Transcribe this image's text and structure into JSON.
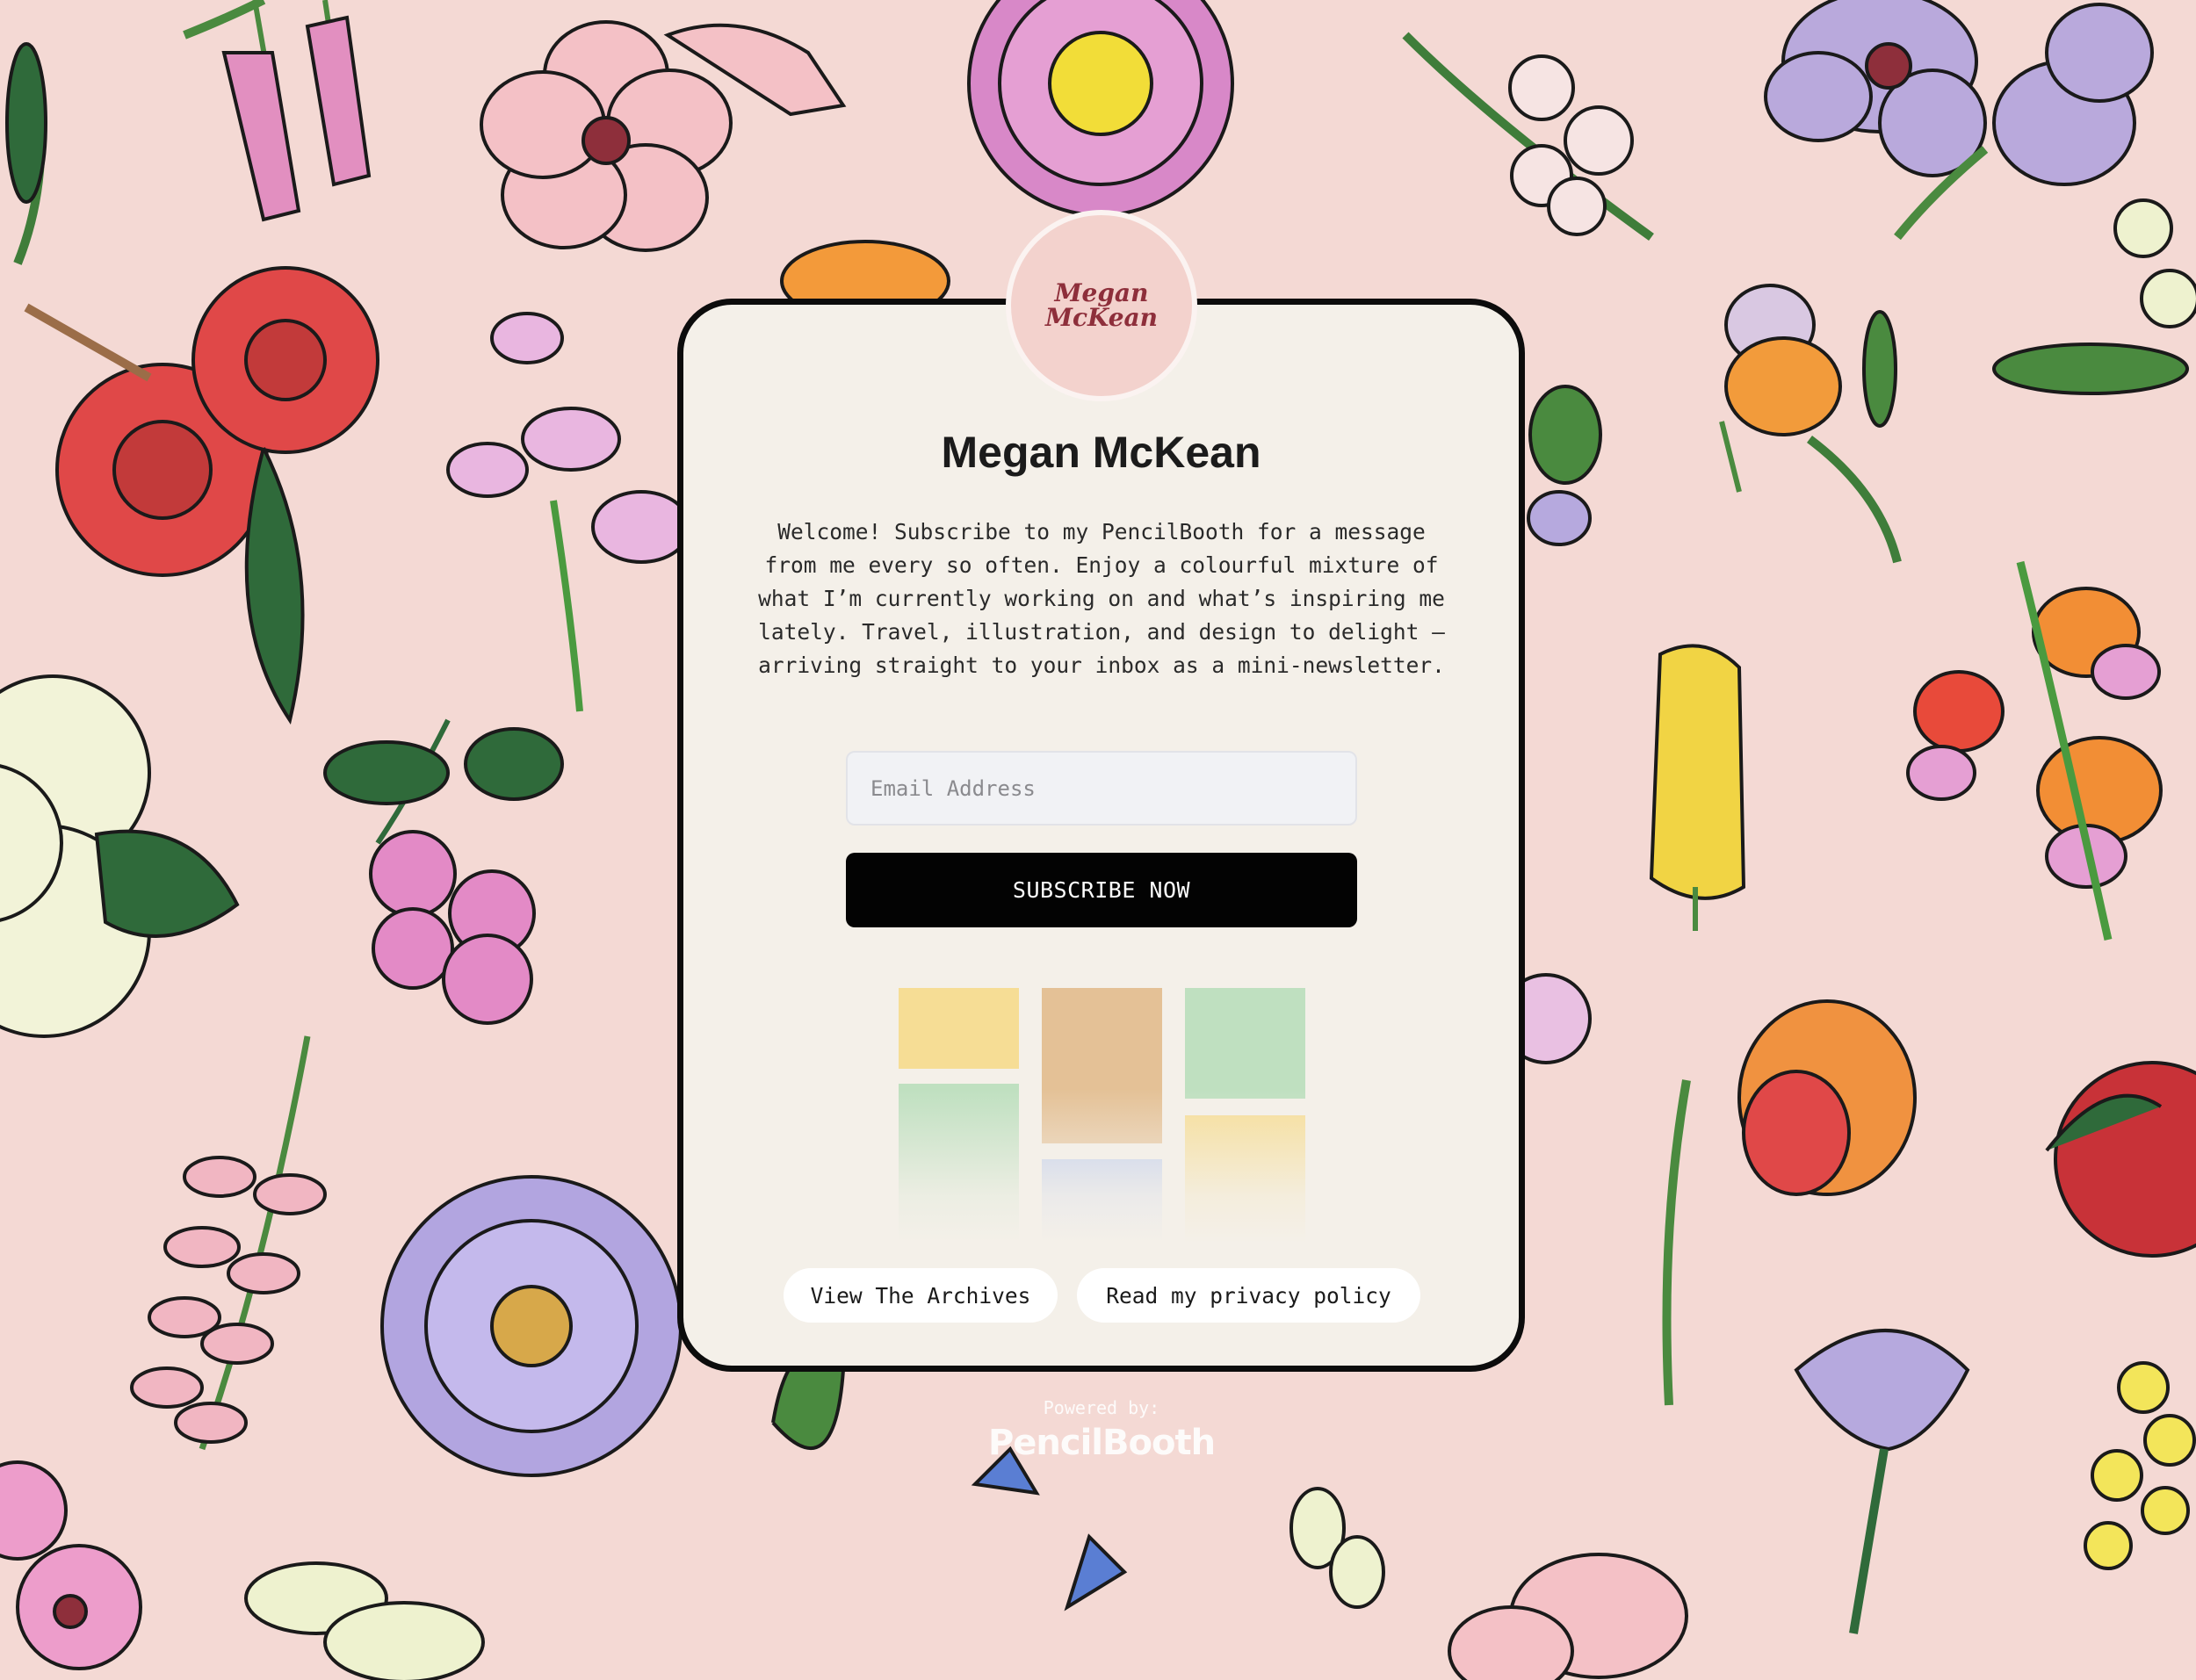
{
  "profile": {
    "logo_line1": "Megan",
    "logo_line2": "McKean",
    "name": "Megan McKean",
    "description": "Welcome! Subscribe to my PencilBooth for a message from me every so often. Enjoy a colourful mixture of what I’m currently working on and what’s inspiring me lately. Travel, illustration, and design to delight — arriving straight to your inbox as a mini-newsletter."
  },
  "form": {
    "email_placeholder": "Email Address",
    "email_value": "",
    "subscribe_label": "SUBSCRIBE NOW"
  },
  "thumbnails": [
    {
      "color": "#f6dd95"
    },
    {
      "color": "#bfe0c0"
    },
    {
      "color": "#e4c196"
    },
    {
      "color": "#b9c9ee"
    },
    {
      "color": "#bfe0c0"
    },
    {
      "color": "#f6dd95"
    }
  ],
  "links": {
    "archives_label": "View The Archives",
    "privacy_label": "Read my privacy policy"
  },
  "footer": {
    "powered_by": "Powered by:",
    "brand": "PencilBooth"
  },
  "colors": {
    "background": "#f4d9d4",
    "card": "#f4f0e9",
    "card_border": "#0c0c0c",
    "logo_circle": "#f3d2cd",
    "logo_text": "#8e2f3b",
    "button": "#030303"
  },
  "icons": {
    "background_art": "botanical-flowers-illustration"
  }
}
